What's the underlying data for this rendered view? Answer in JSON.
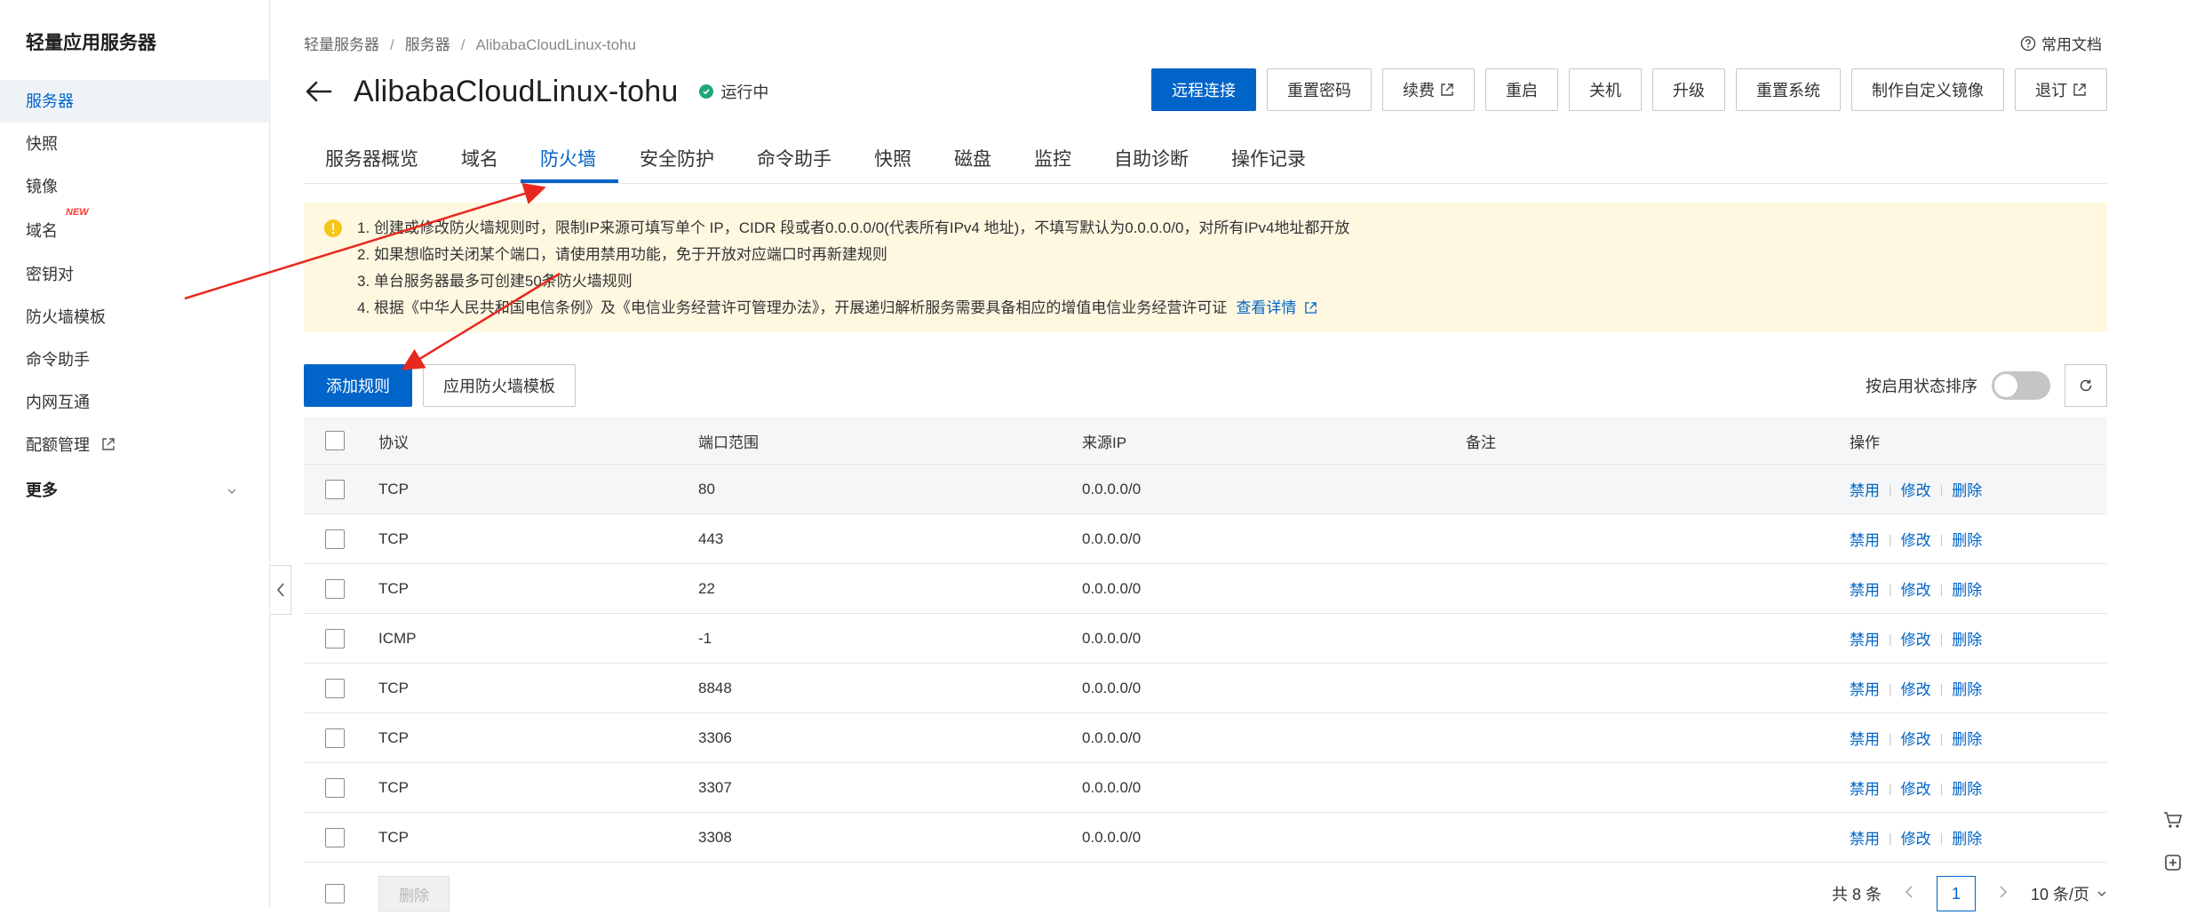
{
  "sidebar": {
    "title": "轻量应用服务器",
    "items": [
      {
        "label": "服务器"
      },
      {
        "label": "快照"
      },
      {
        "label": "镜像"
      },
      {
        "label": "域名",
        "badge": "NEW"
      },
      {
        "label": "密钥对"
      },
      {
        "label": "防火墙模板"
      },
      {
        "label": "命令助手"
      },
      {
        "label": "内网互通"
      },
      {
        "label": "配额管理"
      }
    ],
    "more": "更多"
  },
  "breadcrumb": [
    "轻量服务器",
    "服务器",
    "AlibabaCloudLinux-tohu"
  ],
  "help_doc": "常用文档",
  "header": {
    "title": "AlibabaCloudLinux-tohu",
    "status": "运行中",
    "status_color": "#1fa67a"
  },
  "actions": [
    "远程连接",
    "重置密码",
    "续费",
    "重启",
    "关机",
    "升级",
    "重置系统",
    "制作自定义镜像",
    "退订"
  ],
  "tabs": [
    "服务器概览",
    "域名",
    "防火墙",
    "安全防护",
    "命令助手",
    "快照",
    "磁盘",
    "监控",
    "自助诊断",
    "操作记录"
  ],
  "active_tab": "防火墙",
  "notice": {
    "lines": [
      "1. 创建或修改防火墙规则时，限制IP来源可填写单个 IP，CIDR 段或者0.0.0.0/0(代表所有IPv4 地址)，不填写默认为0.0.0.0/0，对所有IPv4地址都开放",
      "2. 如果想临时关闭某个端口，请使用禁用功能，免于开放对应端口时再新建规则",
      "3. 单台服务器最多可创建50条防火墙规则",
      "4. 根据《中华人民共和国电信条例》及《电信业务经营许可管理办法》，开展递归解析服务需要具备相应的增值电信业务经营许可证"
    ],
    "link": "查看详情"
  },
  "toolbar": {
    "add_rule": "添加规则",
    "apply_template": "应用防火墙模板",
    "sort_label": "按启用状态排序"
  },
  "table": {
    "headers": [
      "协议",
      "端口范围",
      "来源IP",
      "备注",
      "操作"
    ],
    "rows": [
      {
        "protocol": "TCP",
        "port": "80",
        "source": "0.0.0.0/0",
        "note": ""
      },
      {
        "protocol": "TCP",
        "port": "443",
        "source": "0.0.0.0/0",
        "note": ""
      },
      {
        "protocol": "TCP",
        "port": "22",
        "source": "0.0.0.0/0",
        "note": ""
      },
      {
        "protocol": "ICMP",
        "port": "-1",
        "source": "0.0.0.0/0",
        "note": ""
      },
      {
        "protocol": "TCP",
        "port": "8848",
        "source": "0.0.0.0/0",
        "note": ""
      },
      {
        "protocol": "TCP",
        "port": "3306",
        "source": "0.0.0.0/0",
        "note": ""
      },
      {
        "protocol": "TCP",
        "port": "3307",
        "source": "0.0.0.0/0",
        "note": ""
      },
      {
        "protocol": "TCP",
        "port": "3308",
        "source": "0.0.0.0/0",
        "note": ""
      }
    ],
    "ops": [
      "禁用",
      "修改",
      "删除"
    ]
  },
  "footer": {
    "delete": "删除",
    "total": "共 8 条",
    "page": "1",
    "page_size": "10 条/页"
  },
  "colors": {
    "primary": "#0064c8",
    "notice_bg": "#fff8e1",
    "annotation_arrow": "#e8281e"
  }
}
